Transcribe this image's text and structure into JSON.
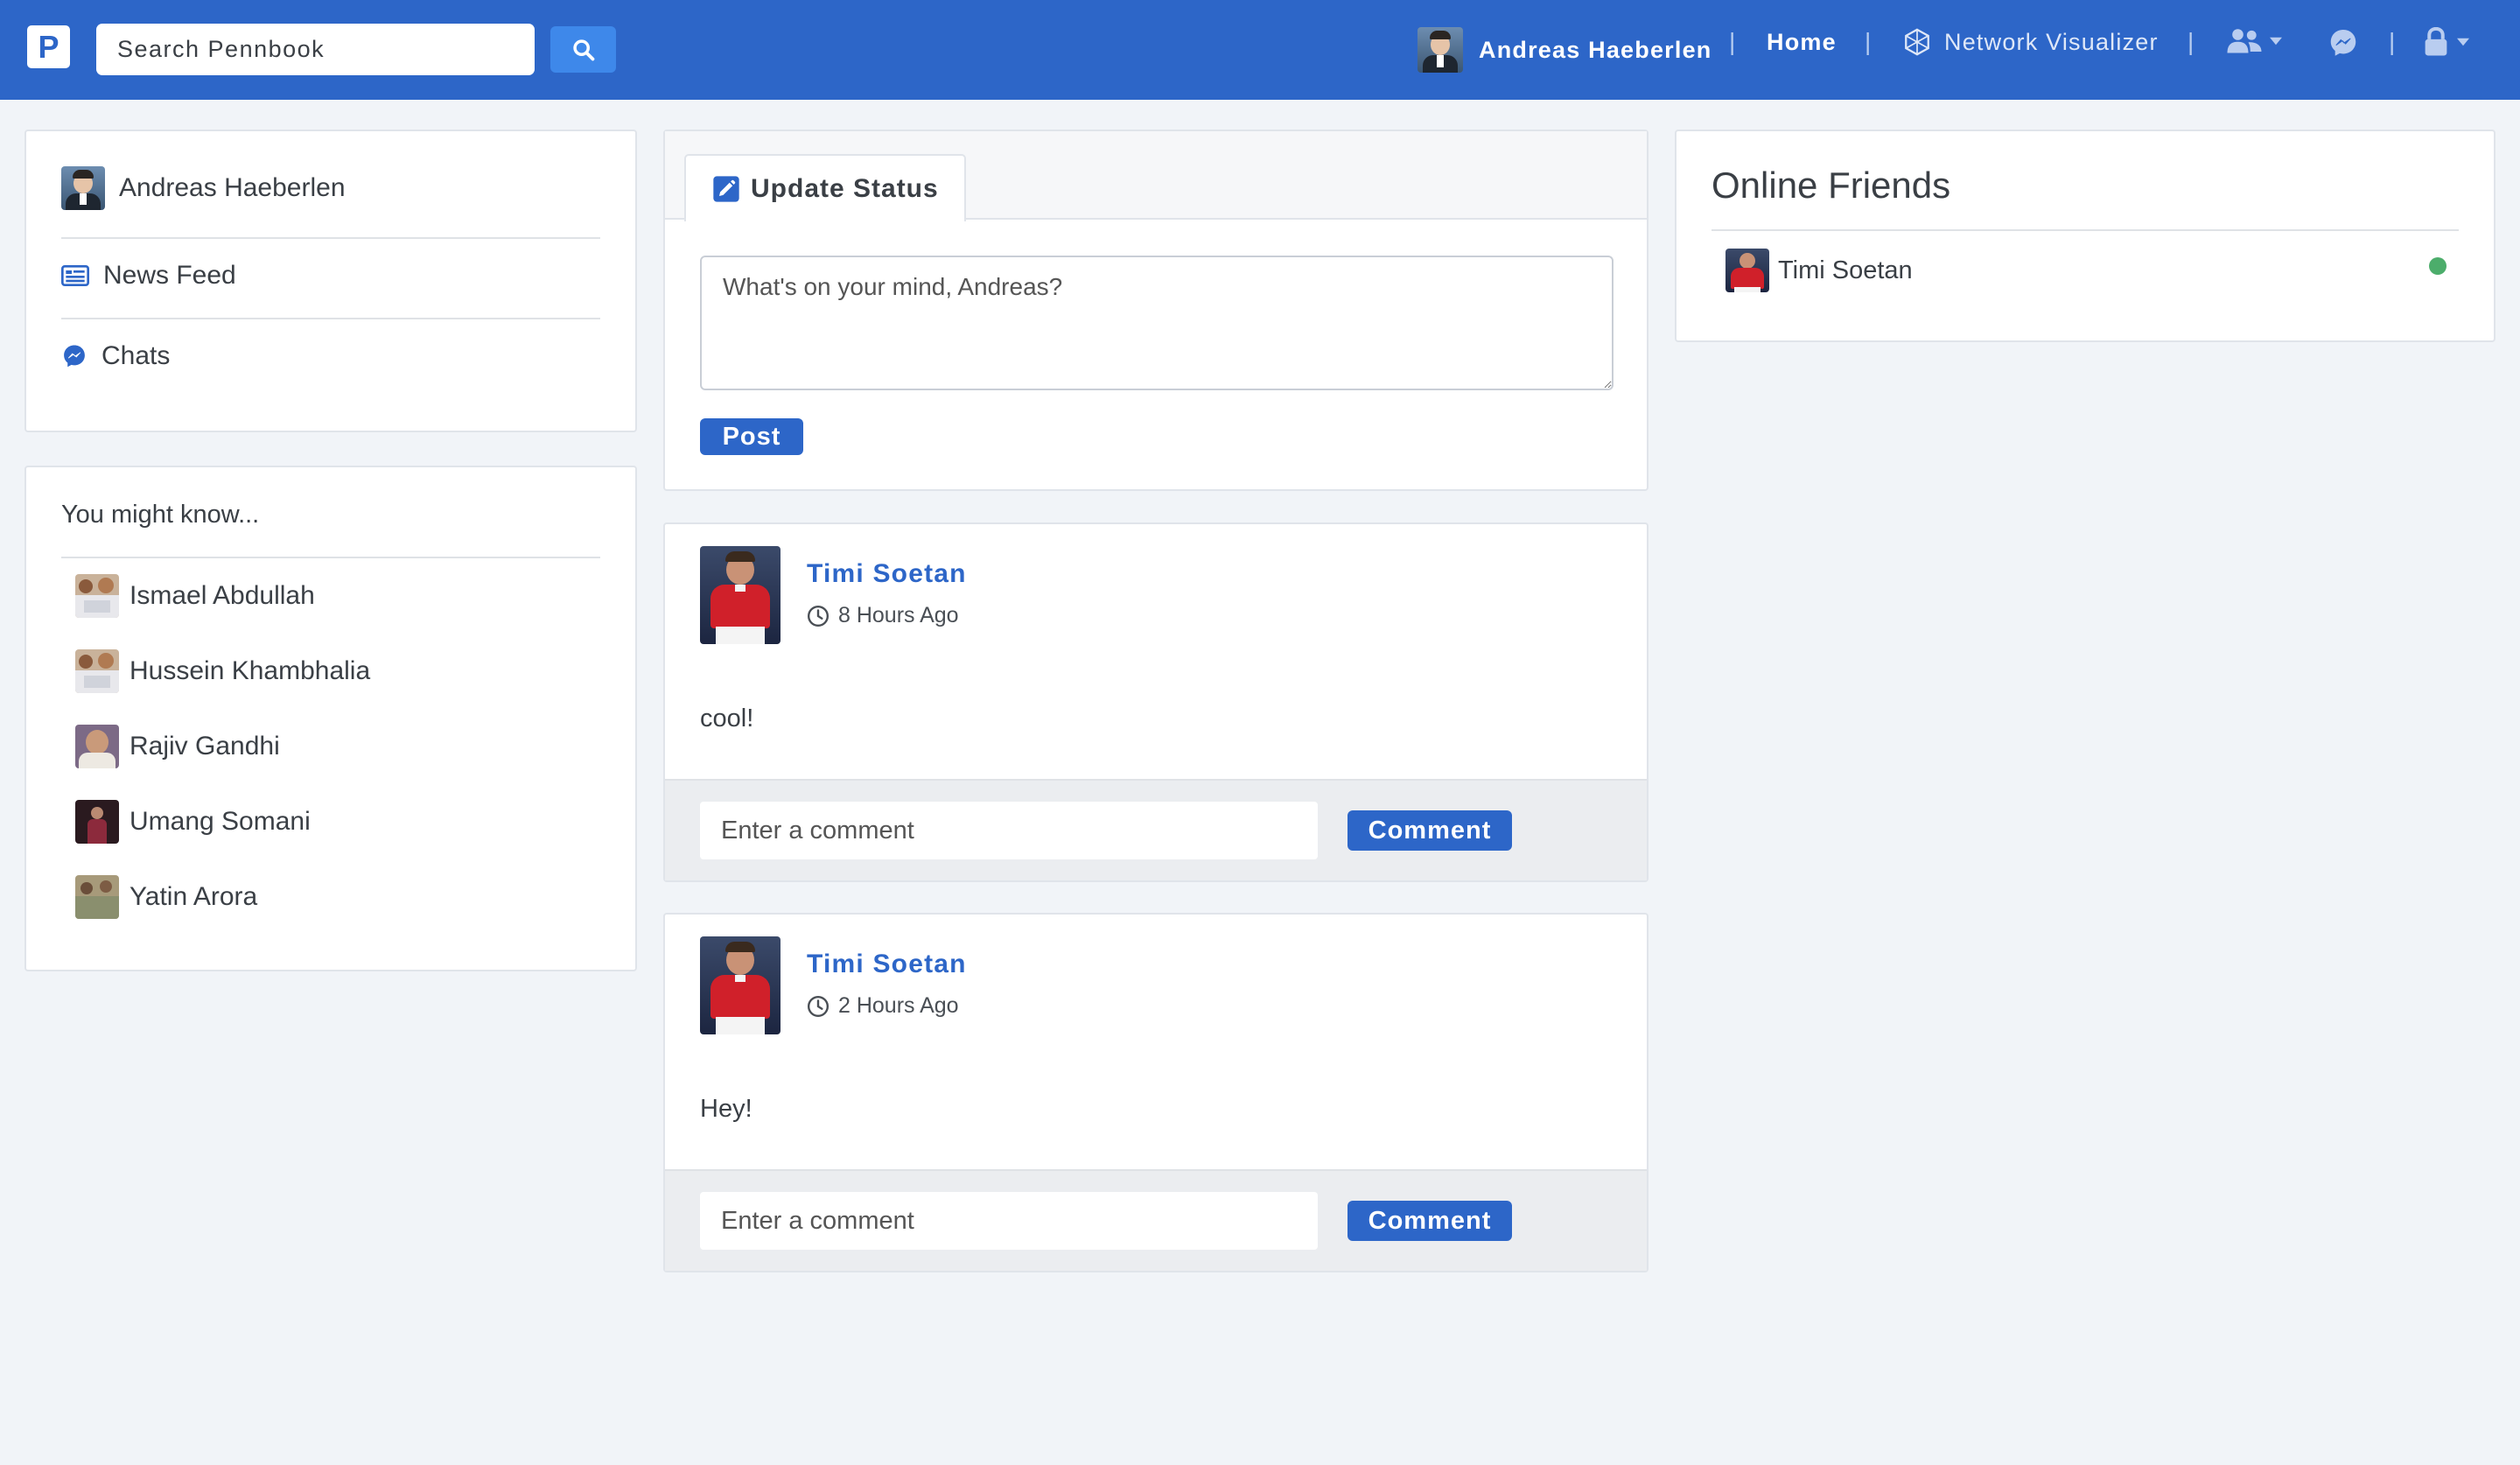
{
  "navbar": {
    "brand_letter": "P",
    "search_placeholder": "Search Pennbook",
    "user_name": "Andreas Haeberlen",
    "home_label": "Home",
    "network_label": "Network Visualizer",
    "separator": "|"
  },
  "sidebar": {
    "profile_name": "Andreas Haeberlen",
    "items": [
      {
        "label": "News Feed",
        "icon": "newspaper-icon"
      },
      {
        "label": "Chats",
        "icon": "messenger-icon"
      }
    ]
  },
  "suggestions": {
    "title": "You might know...",
    "people": [
      {
        "name": "Ismael Abdullah"
      },
      {
        "name": "Hussein Khambhalia"
      },
      {
        "name": "Rajiv Gandhi"
      },
      {
        "name": "Umang Somani"
      },
      {
        "name": "Yatin Arora"
      }
    ]
  },
  "status": {
    "tab_label": "Update Status",
    "placeholder": "What's on your mind, Andreas?",
    "post_button": "Post"
  },
  "posts": [
    {
      "author": "Timi Soetan",
      "time": "8 Hours Ago",
      "body": "cool!",
      "comment_placeholder": "Enter a comment",
      "comment_button": "Comment"
    },
    {
      "author": "Timi Soetan",
      "time": "2 Hours Ago",
      "body": "Hey!",
      "comment_placeholder": "Enter a comment",
      "comment_button": "Comment"
    }
  ],
  "online": {
    "title": "Online Friends",
    "friends": [
      {
        "name": "Timi Soetan",
        "status_color": "#4cad6b"
      }
    ]
  },
  "colors": {
    "brand": "#2d66c8",
    "search_button": "#3e88ea",
    "page_background": "#f1f4f8"
  }
}
